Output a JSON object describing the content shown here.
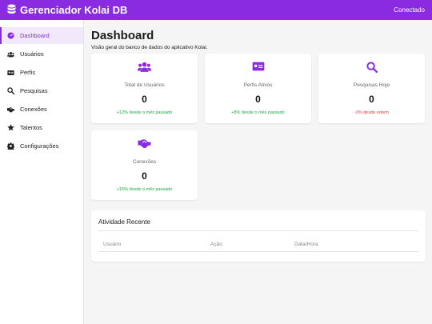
{
  "header": {
    "title": "Gerenciador Kolai DB",
    "status": "Conectado"
  },
  "sidebar": {
    "items": [
      {
        "label": "Dashboard",
        "icon": "gauge-icon"
      },
      {
        "label": "Usuários",
        "icon": "users-icon"
      },
      {
        "label": "Perfis",
        "icon": "id-card-icon"
      },
      {
        "label": "Pesquisas",
        "icon": "search-icon"
      },
      {
        "label": "Conexões",
        "icon": "handshake-icon"
      },
      {
        "label": "Talentos",
        "icon": "star-icon"
      },
      {
        "label": "Configurações",
        "icon": "gear-icon"
      }
    ]
  },
  "main": {
    "title": "Dashboard",
    "subtitle": "Visão geral do banco de dados do aplicativo Kolai.",
    "cards": [
      {
        "label": "Total de Usuários",
        "value": "0",
        "change": "+12% desde o mês passado",
        "icon": "users-icon",
        "trend": "up"
      },
      {
        "label": "Perfis Ativos",
        "value": "0",
        "change": "+8% desde o mês passado",
        "icon": "id-card-icon",
        "trend": "up"
      },
      {
        "label": "Pesquisas Hoje",
        "value": "0",
        "change": "-3% desde ontem",
        "icon": "search-icon",
        "trend": "down"
      },
      {
        "label": "Conexões",
        "value": "0",
        "change": "+15% desde o mês passado",
        "icon": "handshake-icon",
        "trend": "up"
      }
    ],
    "activity": {
      "title": "Atividade Recente",
      "columns": [
        "Usuário",
        "Ação",
        "Data/Hora"
      ]
    }
  },
  "colors": {
    "accent": "#8a2be2",
    "positive": "#22a447",
    "negative": "#e53935"
  }
}
